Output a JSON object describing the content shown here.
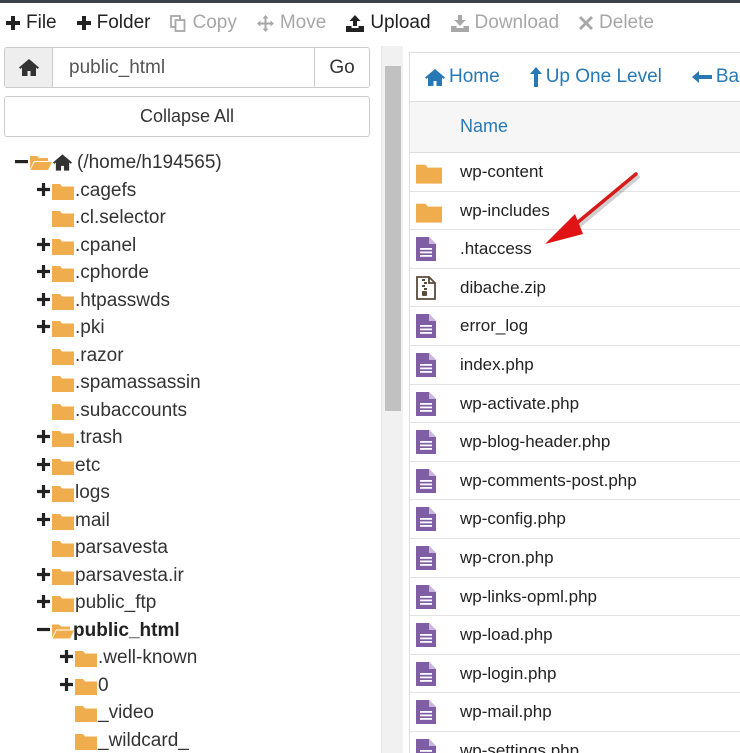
{
  "colors": {
    "folder": "#f0ad4e",
    "file_icon": "#7f5ea6",
    "link": "#2779b5",
    "arrow": "#e01414"
  },
  "toolbar": {
    "file_label": "File",
    "folder_label": "Folder",
    "copy_label": "Copy",
    "move_label": "Move",
    "upload_label": "Upload",
    "download_label": "Download",
    "delete_label": "Delete"
  },
  "path_bar": {
    "value": "public_html",
    "go_label": "Go"
  },
  "collapse_label": "Collapse All",
  "tree": {
    "root_label": "(/home/h194565)",
    "items": [
      {
        "label": ".cagefs",
        "toggle": "plus"
      },
      {
        "label": ".cl.selector",
        "toggle": "none"
      },
      {
        "label": ".cpanel",
        "toggle": "plus"
      },
      {
        "label": ".cphorde",
        "toggle": "plus"
      },
      {
        "label": ".htpasswds",
        "toggle": "plus"
      },
      {
        "label": ".pki",
        "toggle": "plus"
      },
      {
        "label": ".razor",
        "toggle": "none"
      },
      {
        "label": ".spamassassin",
        "toggle": "none"
      },
      {
        "label": ".subaccounts",
        "toggle": "none"
      },
      {
        "label": ".trash",
        "toggle": "plus"
      },
      {
        "label": "etc",
        "toggle": "plus"
      },
      {
        "label": "logs",
        "toggle": "plus"
      },
      {
        "label": "mail",
        "toggle": "plus"
      },
      {
        "label": "parsavesta",
        "toggle": "none"
      },
      {
        "label": "parsavesta.ir",
        "toggle": "plus"
      },
      {
        "label": "public_ftp",
        "toggle": "plus"
      },
      {
        "label": "public_html",
        "toggle": "minus",
        "open": true,
        "selected": true
      },
      {
        "label": ".well-known",
        "toggle": "plus",
        "child": true
      },
      {
        "label": "0",
        "toggle": "plus",
        "child": true
      },
      {
        "label": "_video",
        "toggle": "none",
        "child": true
      },
      {
        "label": "_wildcard_",
        "toggle": "none",
        "child": true
      }
    ]
  },
  "nav": {
    "home_label": "Home",
    "up_label": "Up One Level",
    "back_label": "Back"
  },
  "table": {
    "name_header": "Name",
    "rows": [
      {
        "name": "wp-content",
        "icon": "folder-icon"
      },
      {
        "name": "wp-includes",
        "icon": "folder-icon"
      },
      {
        "name": ".htaccess",
        "icon": "file-text-icon"
      },
      {
        "name": "dibache.zip",
        "icon": "file-zip-icon"
      },
      {
        "name": "error_log",
        "icon": "file-text-icon"
      },
      {
        "name": "index.php",
        "icon": "file-text-icon"
      },
      {
        "name": "wp-activate.php",
        "icon": "file-text-icon"
      },
      {
        "name": "wp-blog-header.php",
        "icon": "file-text-icon"
      },
      {
        "name": "wp-comments-post.php",
        "icon": "file-text-icon"
      },
      {
        "name": "wp-config.php",
        "icon": "file-text-icon"
      },
      {
        "name": "wp-cron.php",
        "icon": "file-text-icon"
      },
      {
        "name": "wp-links-opml.php",
        "icon": "file-text-icon"
      },
      {
        "name": "wp-load.php",
        "icon": "file-text-icon"
      },
      {
        "name": "wp-login.php",
        "icon": "file-text-icon"
      },
      {
        "name": "wp-mail.php",
        "icon": "file-text-icon"
      },
      {
        "name": "wp-settings.php",
        "icon": "file-text-icon"
      }
    ]
  }
}
